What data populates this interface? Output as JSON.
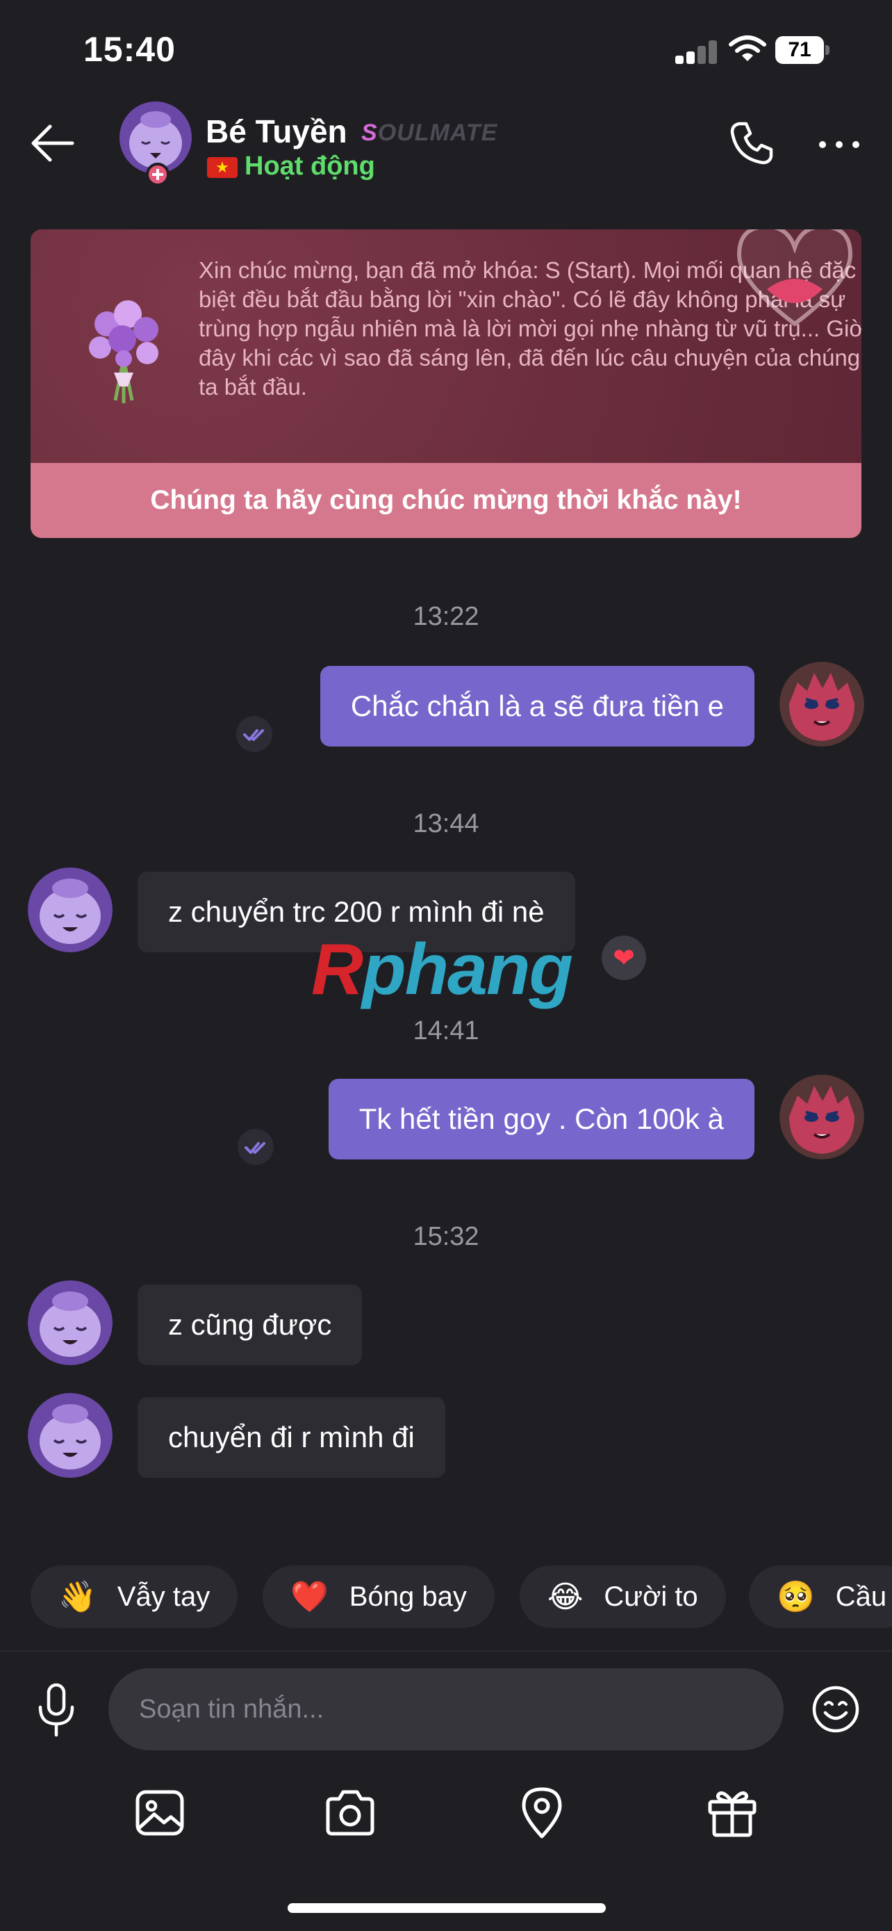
{
  "status_bar": {
    "time": "15:40",
    "battery": "71"
  },
  "header": {
    "name": "Bé Tuyền",
    "tag_first": "S",
    "tag_rest": "OULMATE",
    "flag": "★",
    "status": "Hoạt động",
    "icons": [
      "back-arrow-icon",
      "phone-icon",
      "more-icon"
    ]
  },
  "banner": {
    "text": "Xin chúc mừng, bạn đã mở khóa: S (Start). Mọi mối quan hệ đặc biệt đều bắt đầu bằng lời \"xin chào\". Có lẽ đây không phải là sự trùng hợp ngẫu nhiên mà là lời mời gọi nhẹ nhàng từ vũ trụ... Giờ đây khi các vì sao đã sáng lên, đã đến lúc câu chuyện của chúng ta bắt đầu.",
    "cta": "Chúng ta hãy cùng chúc mừng thời khắc này!"
  },
  "messages": [
    {
      "time": "13:22",
      "text": "Chắc chắn là a sẽ đưa tiền e",
      "direction": "sent"
    },
    {
      "time": "13:44",
      "text": "z chuyển trc 200 r mình đi nè",
      "direction": "received",
      "reaction": "❤"
    },
    {
      "time": "14:41",
      "text": "Tk hết tiền goy . Còn 100k à",
      "direction": "sent"
    },
    {
      "time": "15:32",
      "text": "z cũng được",
      "direction": "received"
    },
    {
      "time": "",
      "text": "chuyển đi r mình đi",
      "direction": "received"
    }
  ],
  "watermark": {
    "first": "R",
    "rest": "phang"
  },
  "quick_replies": [
    {
      "emoji": "👋",
      "label": "Vẫy tay"
    },
    {
      "emoji": "❤️",
      "label": "Bóng bay"
    },
    {
      "emoji": "😂",
      "label": "Cười to"
    },
    {
      "emoji": "🥺",
      "label": "Cầu"
    }
  ],
  "input": {
    "placeholder": "Soạn tin nhắn..."
  },
  "toolbar": {
    "icons": [
      "image-icon",
      "camera-icon",
      "location-icon",
      "gift-icon"
    ]
  },
  "colors": {
    "background": "#1f1e23",
    "sent_bubble": "#7766cc",
    "received_bubble": "#2d2c33",
    "online": "#5fdd6c",
    "banner_cta": "#d5778d"
  }
}
